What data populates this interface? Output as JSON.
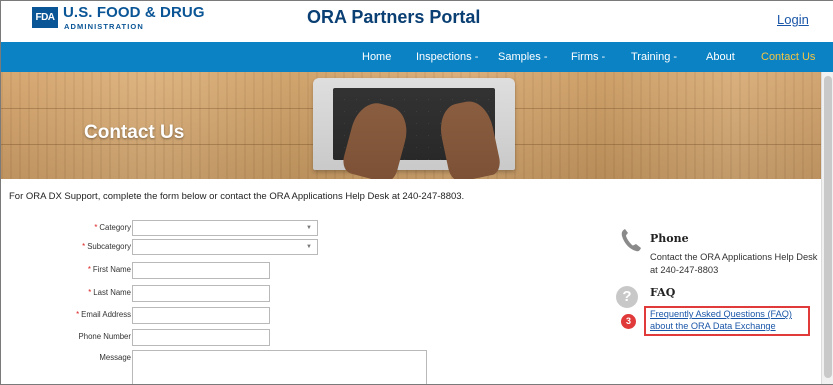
{
  "header": {
    "logo_abbr": "FDA",
    "logo_title": "U.S. FOOD & DRUG",
    "logo_subtitle": "ADMINISTRATION",
    "portal_title": "ORA Partners Portal",
    "login_label": "Login"
  },
  "nav": {
    "items": [
      {
        "label": "Home"
      },
      {
        "label": "Inspections -"
      },
      {
        "label": "Samples -"
      },
      {
        "label": "Firms -"
      },
      {
        "label": "Training -"
      },
      {
        "label": "About"
      },
      {
        "label": "Contact Us"
      }
    ],
    "active_color": "#f4c542",
    "bar_color": "#0b82c4"
  },
  "hero": {
    "title": "Contact Us"
  },
  "intro_text": "For ORA DX Support, complete the form below or contact the ORA Applications Help Desk at 240-247-8803.",
  "form": {
    "category_label": "Category",
    "subcategory_label": "Subcategory",
    "first_name_label": "First Name",
    "last_name_label": "Last Name",
    "email_label": "Email Address",
    "phone_label": "Phone Number",
    "message_label": "Message",
    "required_mark": "*"
  },
  "sidebar": {
    "phone_heading": "Phone",
    "phone_text_line1": "Contact the ORA Applications Help Desk",
    "phone_text_line2": "at 240-247-8803",
    "faq_heading": "FAQ",
    "faq_link_line1": "Frequently Asked Questions (FAQ)",
    "faq_link_line2": "about the ORA Data Exchange",
    "step_number": "3"
  },
  "colors": {
    "brand_blue": "#0a5596",
    "highlight_red": "#e03a3a"
  }
}
